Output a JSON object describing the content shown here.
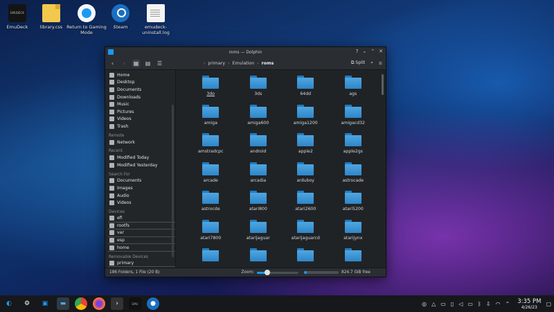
{
  "desktop": {
    "icons": [
      {
        "label": "EmuDeck",
        "badge": "EMUDECK"
      },
      {
        "label": "library.css"
      },
      {
        "label": "Return to Gaming Mode"
      },
      {
        "label": "Steam"
      },
      {
        "label": "emudeck-uninstall.log"
      }
    ]
  },
  "window": {
    "title": "roms — Dolphin",
    "breadcrumb": [
      "primary",
      "Emulation",
      "roms"
    ],
    "split_label": "Split",
    "sidebar": {
      "places": [
        "Home",
        "Desktop",
        "Documents",
        "Downloads",
        "Music",
        "Pictures",
        "Videos",
        "Trash"
      ],
      "remote_header": "Remote",
      "remote": [
        "Network"
      ],
      "recent_header": "Recent",
      "recent": [
        "Modified Today",
        "Modified Yesterday"
      ],
      "search_header": "Search For",
      "search": [
        "Documents",
        "Images",
        "Audio",
        "Videos"
      ],
      "devices_header": "Devices",
      "devices": [
        "efi",
        "rootfs",
        "var",
        "esp",
        "home"
      ],
      "removable_header": "Removable Devices",
      "removable": [
        "primary"
      ]
    },
    "folders": [
      "3do",
      "3ds",
      "64dd",
      "ags",
      "amiga",
      "amiga600",
      "amiga1200",
      "amigacd32",
      "amstradcpc",
      "android",
      "apple2",
      "apple2gs",
      "arcade",
      "arcadia",
      "arduboy",
      "astrocade",
      "astrocde",
      "atari800",
      "atari2600",
      "atari5200",
      "atari7800",
      "atarijaguar",
      "atarijaguarcd",
      "atarijynx",
      "",
      "",
      "",
      ""
    ],
    "status": {
      "summary": "186 Folders, 1 File (20 B)",
      "zoom_label": "Zoom:",
      "zoom_level": 0.25,
      "disk_used_fraction": 0.08,
      "free_space": "824.7 GiB free"
    }
  },
  "taskbar": {
    "time": "3:35 PM",
    "date": "4/26/23"
  }
}
